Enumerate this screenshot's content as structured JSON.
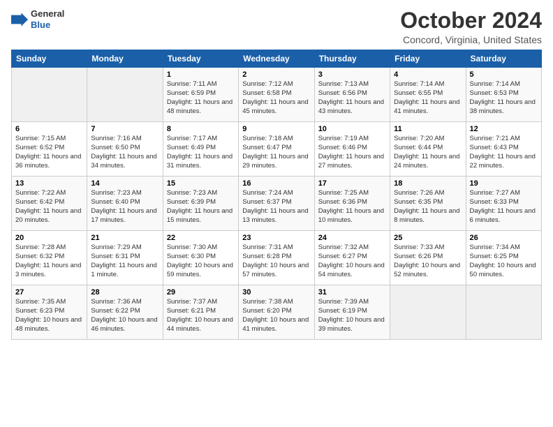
{
  "header": {
    "logo_line1": "General",
    "logo_line2": "Blue",
    "month": "October 2024",
    "location": "Concord, Virginia, United States"
  },
  "weekdays": [
    "Sunday",
    "Monday",
    "Tuesday",
    "Wednesday",
    "Thursday",
    "Friday",
    "Saturday"
  ],
  "weeks": [
    [
      {
        "day": "",
        "info": ""
      },
      {
        "day": "",
        "info": ""
      },
      {
        "day": "1",
        "info": "Sunrise: 7:11 AM\nSunset: 6:59 PM\nDaylight: 11 hours and 48 minutes."
      },
      {
        "day": "2",
        "info": "Sunrise: 7:12 AM\nSunset: 6:58 PM\nDaylight: 11 hours and 45 minutes."
      },
      {
        "day": "3",
        "info": "Sunrise: 7:13 AM\nSunset: 6:56 PM\nDaylight: 11 hours and 43 minutes."
      },
      {
        "day": "4",
        "info": "Sunrise: 7:14 AM\nSunset: 6:55 PM\nDaylight: 11 hours and 41 minutes."
      },
      {
        "day": "5",
        "info": "Sunrise: 7:14 AM\nSunset: 6:53 PM\nDaylight: 11 hours and 38 minutes."
      }
    ],
    [
      {
        "day": "6",
        "info": "Sunrise: 7:15 AM\nSunset: 6:52 PM\nDaylight: 11 hours and 36 minutes."
      },
      {
        "day": "7",
        "info": "Sunrise: 7:16 AM\nSunset: 6:50 PM\nDaylight: 11 hours and 34 minutes."
      },
      {
        "day": "8",
        "info": "Sunrise: 7:17 AM\nSunset: 6:49 PM\nDaylight: 11 hours and 31 minutes."
      },
      {
        "day": "9",
        "info": "Sunrise: 7:18 AM\nSunset: 6:47 PM\nDaylight: 11 hours and 29 minutes."
      },
      {
        "day": "10",
        "info": "Sunrise: 7:19 AM\nSunset: 6:46 PM\nDaylight: 11 hours and 27 minutes."
      },
      {
        "day": "11",
        "info": "Sunrise: 7:20 AM\nSunset: 6:44 PM\nDaylight: 11 hours and 24 minutes."
      },
      {
        "day": "12",
        "info": "Sunrise: 7:21 AM\nSunset: 6:43 PM\nDaylight: 11 hours and 22 minutes."
      }
    ],
    [
      {
        "day": "13",
        "info": "Sunrise: 7:22 AM\nSunset: 6:42 PM\nDaylight: 11 hours and 20 minutes."
      },
      {
        "day": "14",
        "info": "Sunrise: 7:23 AM\nSunset: 6:40 PM\nDaylight: 11 hours and 17 minutes."
      },
      {
        "day": "15",
        "info": "Sunrise: 7:23 AM\nSunset: 6:39 PM\nDaylight: 11 hours and 15 minutes."
      },
      {
        "day": "16",
        "info": "Sunrise: 7:24 AM\nSunset: 6:37 PM\nDaylight: 11 hours and 13 minutes."
      },
      {
        "day": "17",
        "info": "Sunrise: 7:25 AM\nSunset: 6:36 PM\nDaylight: 11 hours and 10 minutes."
      },
      {
        "day": "18",
        "info": "Sunrise: 7:26 AM\nSunset: 6:35 PM\nDaylight: 11 hours and 8 minutes."
      },
      {
        "day": "19",
        "info": "Sunrise: 7:27 AM\nSunset: 6:33 PM\nDaylight: 11 hours and 6 minutes."
      }
    ],
    [
      {
        "day": "20",
        "info": "Sunrise: 7:28 AM\nSunset: 6:32 PM\nDaylight: 11 hours and 3 minutes."
      },
      {
        "day": "21",
        "info": "Sunrise: 7:29 AM\nSunset: 6:31 PM\nDaylight: 11 hours and 1 minute."
      },
      {
        "day": "22",
        "info": "Sunrise: 7:30 AM\nSunset: 6:30 PM\nDaylight: 10 hours and 59 minutes."
      },
      {
        "day": "23",
        "info": "Sunrise: 7:31 AM\nSunset: 6:28 PM\nDaylight: 10 hours and 57 minutes."
      },
      {
        "day": "24",
        "info": "Sunrise: 7:32 AM\nSunset: 6:27 PM\nDaylight: 10 hours and 54 minutes."
      },
      {
        "day": "25",
        "info": "Sunrise: 7:33 AM\nSunset: 6:26 PM\nDaylight: 10 hours and 52 minutes."
      },
      {
        "day": "26",
        "info": "Sunrise: 7:34 AM\nSunset: 6:25 PM\nDaylight: 10 hours and 50 minutes."
      }
    ],
    [
      {
        "day": "27",
        "info": "Sunrise: 7:35 AM\nSunset: 6:23 PM\nDaylight: 10 hours and 48 minutes."
      },
      {
        "day": "28",
        "info": "Sunrise: 7:36 AM\nSunset: 6:22 PM\nDaylight: 10 hours and 46 minutes."
      },
      {
        "day": "29",
        "info": "Sunrise: 7:37 AM\nSunset: 6:21 PM\nDaylight: 10 hours and 44 minutes."
      },
      {
        "day": "30",
        "info": "Sunrise: 7:38 AM\nSunset: 6:20 PM\nDaylight: 10 hours and 41 minutes."
      },
      {
        "day": "31",
        "info": "Sunrise: 7:39 AM\nSunset: 6:19 PM\nDaylight: 10 hours and 39 minutes."
      },
      {
        "day": "",
        "info": ""
      },
      {
        "day": "",
        "info": ""
      }
    ]
  ]
}
